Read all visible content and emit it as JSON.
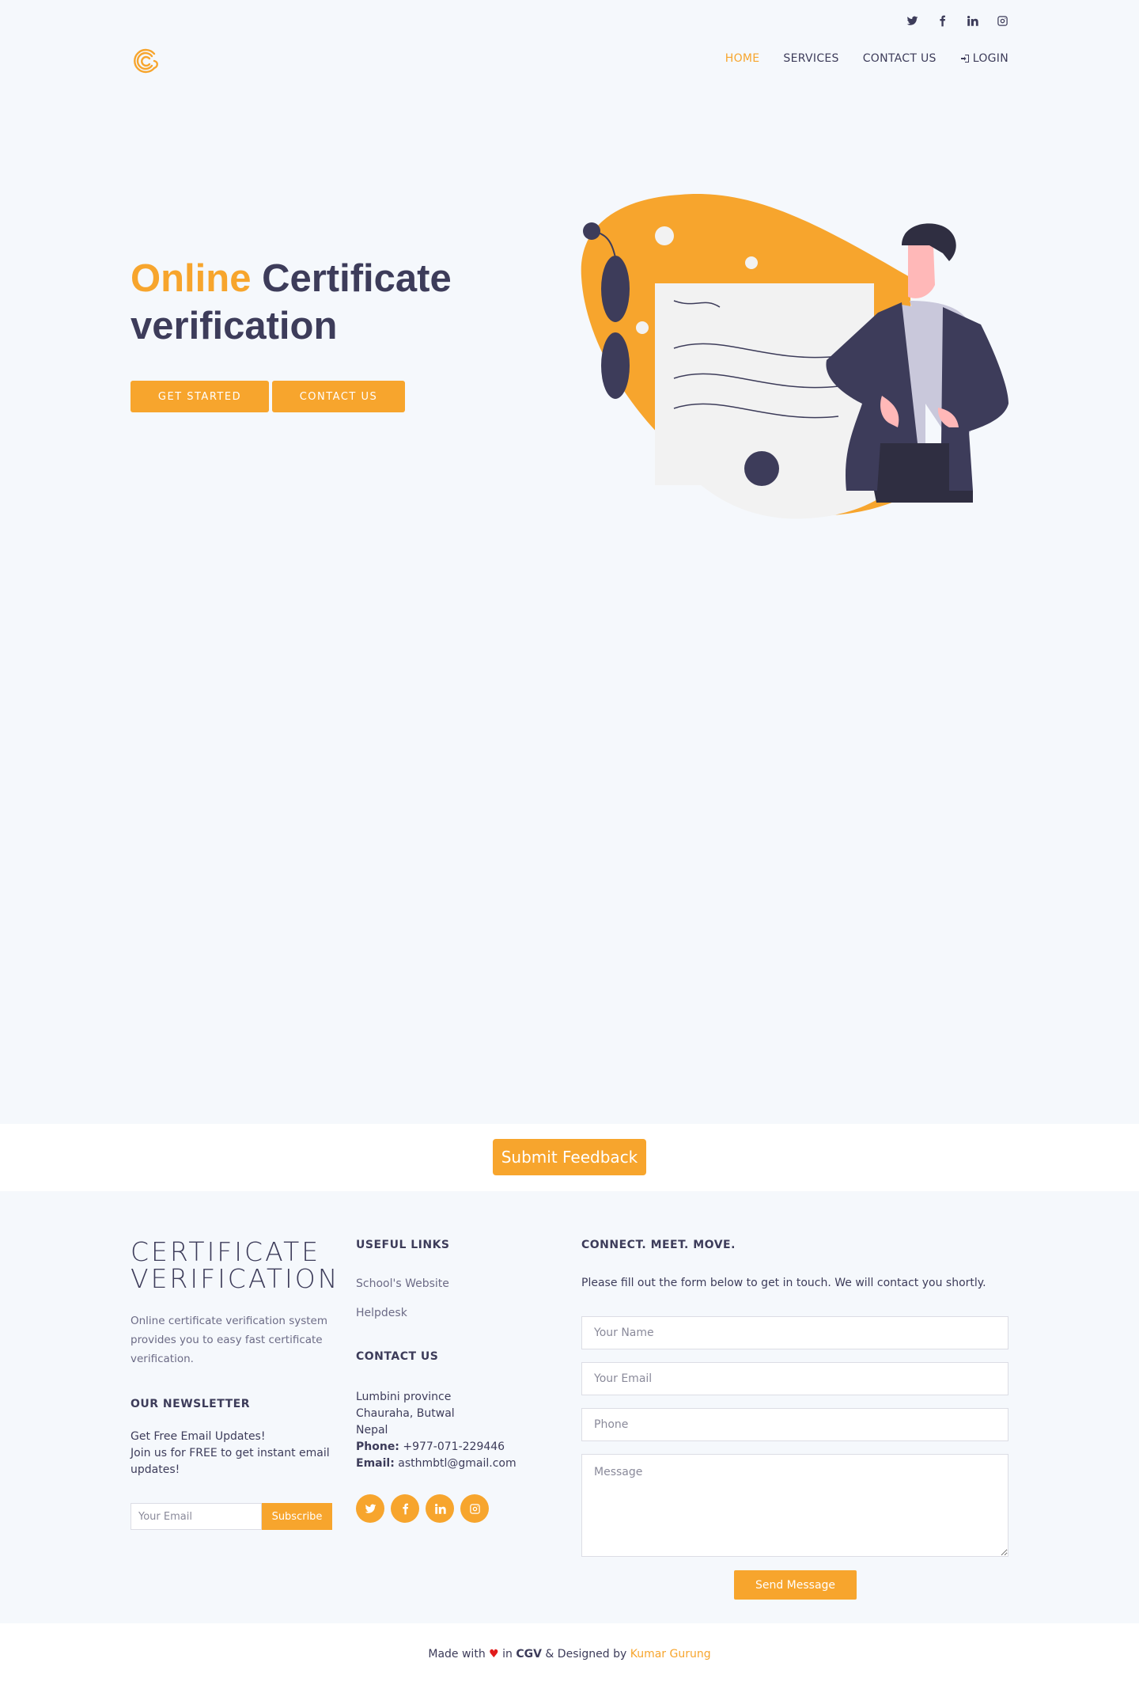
{
  "topbar": {
    "social": [
      {
        "icon": "twitter-icon"
      },
      {
        "icon": "facebook-icon"
      },
      {
        "icon": "linkedin-icon"
      },
      {
        "icon": "instagram-icon"
      }
    ]
  },
  "nav": {
    "items": [
      {
        "label": "HOME",
        "active": true
      },
      {
        "label": "SERVICES",
        "active": false
      },
      {
        "label": "CONTACT US",
        "active": false
      },
      {
        "label": "LOGIN",
        "icon": "sign-in-icon",
        "active": false
      }
    ]
  },
  "hero": {
    "title_accent": "Online",
    "title_rest": " Certificate verification",
    "btn_get_started": "GET STARTED",
    "btn_contact": "CONTACT US"
  },
  "feedback": {
    "button_label": "Submit Feedback"
  },
  "footer": {
    "brand_title": "CERTIFICATE VERIFICATION",
    "brand_desc": "Online certificate verification system provides you to easy fast certificate verification.",
    "newsletter_heading": "OUR NEWSLETTER",
    "newsletter_line1": "Get Free Email Updates!",
    "newsletter_line2": "Join us for FREE to get instant email updates!",
    "newsletter_placeholder": "Your Email",
    "newsletter_button": "Subscribe",
    "useful_links_heading": "USEFUL LINKS",
    "useful_links": [
      "School's Website",
      "Helpdesk"
    ],
    "contact_heading": "CONTACT US",
    "address_lines": [
      "Lumbini province",
      "Chauraha, Butwal",
      "Nepal"
    ],
    "phone_label": "Phone:",
    "phone_value": " +977-071-229446",
    "email_label": "Email:",
    "email_value": " asthmbtl@gmail.com",
    "social": [
      {
        "icon": "twitter-icon"
      },
      {
        "icon": "facebook-icon"
      },
      {
        "icon": "linkedin-icon"
      },
      {
        "icon": "instagram-icon"
      }
    ],
    "connect_heading": "CONNECT. MEET. MOVE.",
    "connect_intro": "Please fill out the form below to get in touch. We will contact you shortly.",
    "form": {
      "name_placeholder": "Your Name",
      "email_placeholder": "Your Email",
      "phone_placeholder": "Phone",
      "message_placeholder": "Message",
      "send_button": "Send Message"
    }
  },
  "credits": {
    "made_with": "Made with",
    "heart": "♥",
    "in": " in ",
    "brand": "CGV",
    "designed_by": " & Designed by ",
    "author": "Kumar Gurung"
  },
  "colors": {
    "accent": "#f7a52d",
    "dark": "#3d3c5a",
    "background": "#f5f8fc"
  }
}
